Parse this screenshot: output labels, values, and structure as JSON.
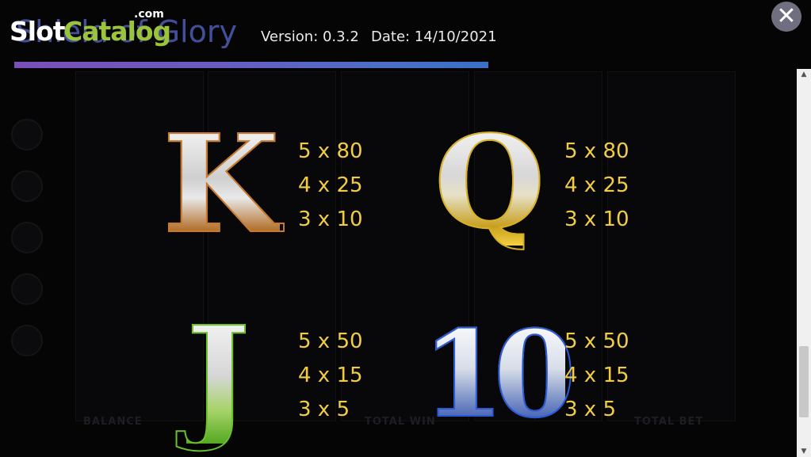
{
  "header": {
    "logo": {
      "slot": "Slot",
      "catalog": "Catalog",
      "com": ".com"
    },
    "game_title": "Shield of Glory",
    "version": "Version: 0.3.2",
    "date": "Date: 14/10/2021",
    "close_icon": "close-icon",
    "accent_bar_colors": [
      "#7a4fb8",
      "#3a6fc6"
    ]
  },
  "paytable": [
    {
      "symbol": "K",
      "symbol_color": "#c9792b",
      "payouts": [
        "5 x 80",
        "4 x 25",
        "3 x 10"
      ]
    },
    {
      "symbol": "Q",
      "symbol_color": "#d8b024",
      "payouts": [
        "5 x 80",
        "4 x 25",
        "3 x 10"
      ]
    },
    {
      "symbol": "J",
      "symbol_color": "#6cc02a",
      "payouts": [
        "5 x 50",
        "4 x 15",
        "3 x 5"
      ]
    },
    {
      "symbol": "10",
      "symbol_color": "#2a5ad8",
      "payouts": [
        "5 x 50",
        "4 x 15",
        "3 x 5"
      ]
    }
  ],
  "background": {
    "balance_label": "BALANCE",
    "total_win_label": "TOTAL WIN",
    "total_bet_label": "TOTAL BET"
  },
  "colors": {
    "payout_text": "#f2cd43",
    "scrollbar": "#f0f0f0"
  }
}
